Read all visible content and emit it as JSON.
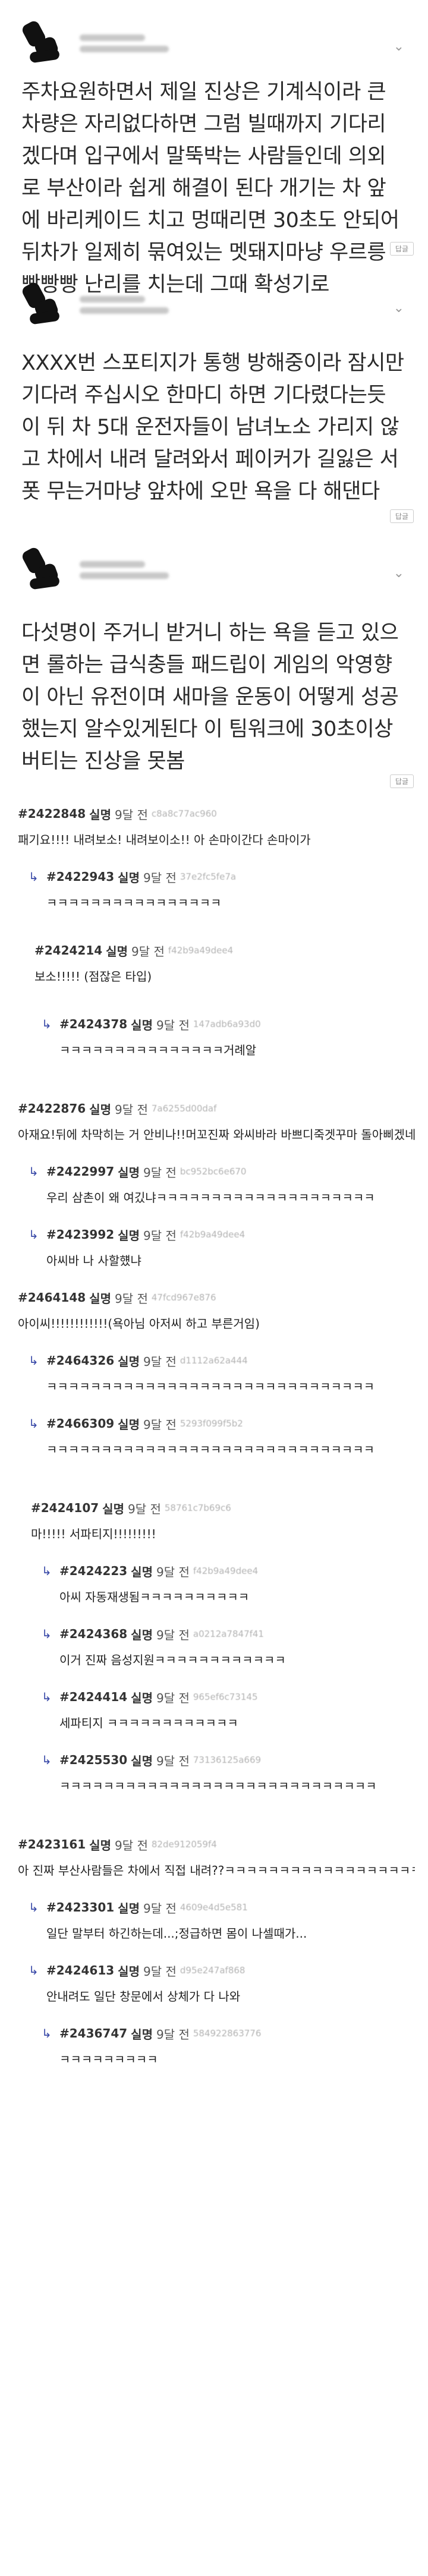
{
  "posts": [
    {
      "body": "주차요원하면서 제일 진상은 기계식이라 큰 차량은 자리없다하면 그럼 빌때까지 기다리겠다며 입구에서 말뚝박는 사람들인데 의외로 부산이라 쉽게 해결이 된다 개기는 차 앞에 바리케이드 치고 멍때리면 30초도 안되어 뒤차가 일제히 묶여있는 멧돼지마냥 우르릉 빵빵빵 난리를 치는데 그때 확성기로",
      "reply_label": "답글"
    },
    {
      "body": "XXXX번 스포티지가 통행 방해중이라 잠시만 기다려 주십시오 한마디 하면 기다렸다는듯이 뒤 차 5대 운전자들이 남녀노소 가리지 않고 차에서 내려 달려와서 페이커가 길잃은 서폿 무는거마냥 앞차에 오만 욕을 다 해댄다",
      "reply_label": "답글"
    },
    {
      "body": "다섯명이 주거니 받거니 하는 욕을 듣고 있으면 롤하는 급식충들 패드립이 게임의 악영향이 아닌 유전이며 새마을 운동이 어떻게 성공했는지 알수있게된다 이 팀워크에 30초이상 버티는 진상을 못봄",
      "reply_label": "답글"
    }
  ],
  "comments": [
    {
      "num": "#2422848",
      "nick": "실명",
      "time": "9달 전",
      "hash": "c8a8c77ac960",
      "text": "패기요!!!! 내려보소! 내려보이소!! 아 손마이간다 손마이가",
      "level": 0
    },
    {
      "num": "#2422943",
      "nick": "실명",
      "time": "9달 전",
      "hash": "37e2fc5fe7a",
      "text": "ㅋㅋㅋㅋㅋㅋㅋㅋㅋㅋㅋㅋㅋㅋㅋㅋ",
      "level": 1
    },
    {
      "num": "#2424214",
      "nick": "실명",
      "time": "9달 전",
      "hash": "f42b9a49dee4",
      "text": "보소!!!!! (점잖은 타입)",
      "level": 1
    },
    {
      "num": "#2424378",
      "nick": "실명",
      "time": "9달 전",
      "hash": "147adb6a93d0",
      "text": "ㅋㅋㅋㅋㅋㅋㅋㅋㅋㅋㅋㅋㅋㅋㅋ거례알",
      "level": 2
    },
    {
      "num": "#2422876",
      "nick": "실명",
      "time": "9달 전",
      "hash": "7a6255d00daf",
      "text": "아재요!뒤에 차막히는 거 안비나!!머꼬진짜 와씨바라 바쁘디죽겟꾸마 돌아삐겠네",
      "level": 0
    },
    {
      "num": "#2422997",
      "nick": "실명",
      "time": "9달 전",
      "hash": "bc952bc6e670",
      "text": "우리 삼촌이 왜 여깄냐ㅋㅋㅋㅋㅋㅋㅋㅋㅋㅋㅋㅋㅋㅋㅋㅋㅋㅋㅋㅋ",
      "level": 1
    },
    {
      "num": "#2423992",
      "nick": "실명",
      "time": "9달 전",
      "hash": "f42b9a49dee4",
      "text": "아씨바 나 사할헀냐",
      "level": 1
    },
    {
      "num": "#2464148",
      "nick": "실명",
      "time": "9달 전",
      "hash": "47fcd967e876",
      "text": "아이씨!!!!!!!!!!!!(욕아님 아저씨 하고 부른거임)",
      "level": 0
    },
    {
      "num": "#2464326",
      "nick": "실명",
      "time": "9달 전",
      "hash": "d1112a62a444",
      "text": "ㅋㅋㅋㅋㅋㅋㅋㅋㅋㅋㅋㅋㅋㅋㅋㅋㅋㅋㅋㅋㅋㅋㅋㅋㅋㅋㅋㅋㅋㅋ",
      "level": 1
    },
    {
      "num": "#2466309",
      "nick": "실명",
      "time": "9달 전",
      "hash": "5293f099f5b2",
      "text": "ㅋㅋㅋㅋㅋㅋㅋㅋㅋㅋㅋㅋㅋㅋㅋㅋㅋㅋㅋㅋㅋㅋㅋㅋㅋㅋㅋㅋㅋㅋ",
      "level": 1
    },
    {
      "num": "#2424107",
      "nick": "실명",
      "time": "9달 전",
      "hash": "58761c7b69c6",
      "text": "마!!!!! 서파티지!!!!!!!!!",
      "level": 0,
      "indent": true
    },
    {
      "num": "#2424223",
      "nick": "실명",
      "time": "9달 전",
      "hash": "f42b9a49dee4",
      "text": "아씨 자동재생됨ㅋㅋㅋㅋㅋㅋㅋㅋㅋㅋ",
      "level": 2
    },
    {
      "num": "#2424368",
      "nick": "실명",
      "time": "9달 전",
      "hash": "a0212a7847f41",
      "text": "이거 진짜 음성지원ㅋㅋㅋㅋㅋㅋㅋㅋㅋㅋㅋㅋ",
      "level": 2
    },
    {
      "num": "#2424414",
      "nick": "실명",
      "time": "9달 전",
      "hash": "965ef6c73145",
      "text": "세파티지 ㅋㅋㅋㅋㅋㅋㅋㅋㅋㅋㅋㅋ",
      "level": 2
    },
    {
      "num": "#2425530",
      "nick": "실명",
      "time": "9달 전",
      "hash": "73136125a669",
      "text": "ㅋㅋㅋㅋㅋㅋㅋㅋㅋㅋㅋㅋㅋㅋㅋㅋㅋㅋㅋㅋㅋㅋㅋㅋㅋㅋㅋㅋㅋ",
      "level": 2
    },
    {
      "num": "#2423161",
      "nick": "실명",
      "time": "9달 전",
      "hash": "82de912059f4",
      "text": "아 진짜 부산사람들은 차에서 직접 내려??ㅋㅋㅋㅋㅋㅋㅋㅋㅋㅋㅋㅋㅋㅋㅋㅋㅋㅋㅋㅋ",
      "level": 0
    },
    {
      "num": "#2423301",
      "nick": "실명",
      "time": "9달 전",
      "hash": "4609e4d5e581",
      "text": "일단 말부터 하긴하는데...;정급하면 몸이 나셀때가...",
      "level": 1
    },
    {
      "num": "#2424613",
      "nick": "실명",
      "time": "9달 전",
      "hash": "d95e247af868",
      "text": "안내려도 일단 창문에서 상체가 다 나와",
      "level": 1
    },
    {
      "num": "#2436747",
      "nick": "실명",
      "time": "9달 전",
      "hash": "584922863776",
      "text": "ㅋㅋㅋㅋㅋㅋㅋㅋㅋ",
      "level": 2
    }
  ],
  "icons": {
    "reply_arrow": "reply-arrow-icon",
    "chevron": "chevron-down-icon"
  },
  "colors": {
    "header_bar": "#e8e8ee",
    "arrow": "#3a4aa8"
  }
}
